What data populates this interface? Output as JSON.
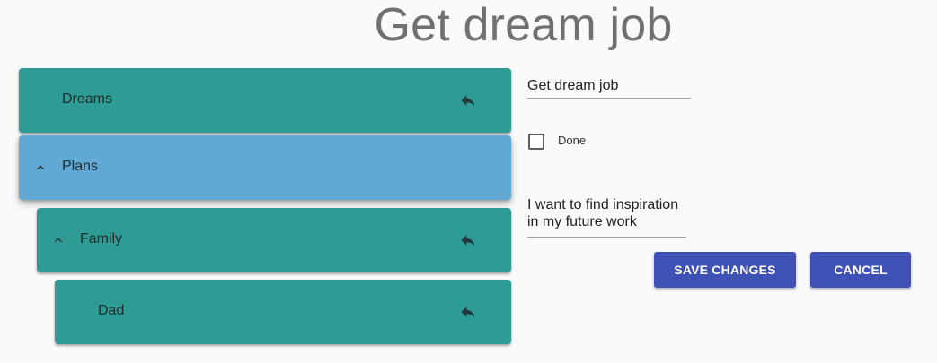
{
  "header": {
    "title": "Get dream job"
  },
  "tree": {
    "items": [
      {
        "label": "Dreams",
        "chevron": false,
        "reply_icon": "reply-icon"
      },
      {
        "label": "Plans",
        "chevron": "chevron-up-icon",
        "reply_icon": null
      },
      {
        "label": "Family",
        "chevron": "chevron-up-icon",
        "reply_icon": "reply-icon"
      },
      {
        "label": "Dad",
        "chevron": false,
        "reply_icon": "reply-icon"
      }
    ]
  },
  "form": {
    "title_value": "Get dream job",
    "done_label": "Done",
    "done_checked": false,
    "description_value": "I want to find inspiration\nin my future work"
  },
  "actions": {
    "save_label": "SAVE CHANGES",
    "cancel_label": "CANCEL"
  },
  "colors": {
    "teal": "#2e9c94",
    "blue_selected": "#61a9d5",
    "primary": "#3f51b5",
    "title_gray": "#707070"
  }
}
